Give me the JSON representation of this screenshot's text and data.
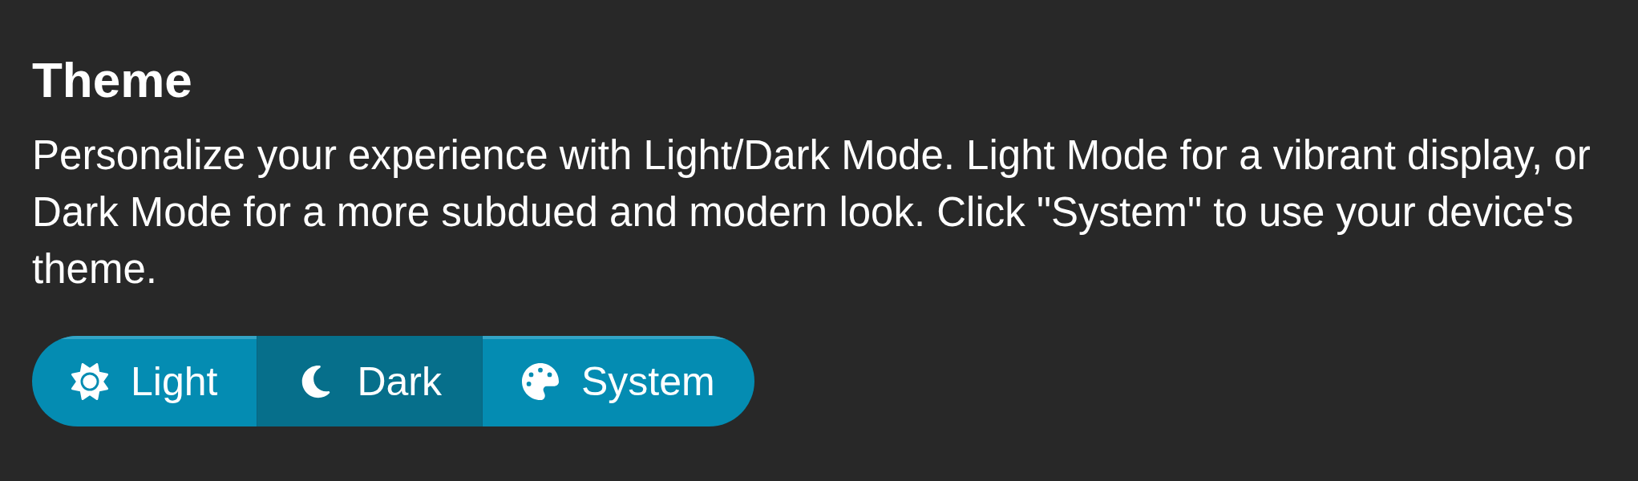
{
  "settings_section": {
    "title": "Theme",
    "description": "Personalize your experience with Light/Dark Mode. Light Mode for a vibrant display, or Dark Mode for a more subdued and modern look. Click \"System\" to use your device's theme."
  },
  "theme_options": [
    {
      "label": "Light",
      "selected": false
    },
    {
      "label": "Dark",
      "selected": true
    },
    {
      "label": "System",
      "selected": false
    }
  ]
}
